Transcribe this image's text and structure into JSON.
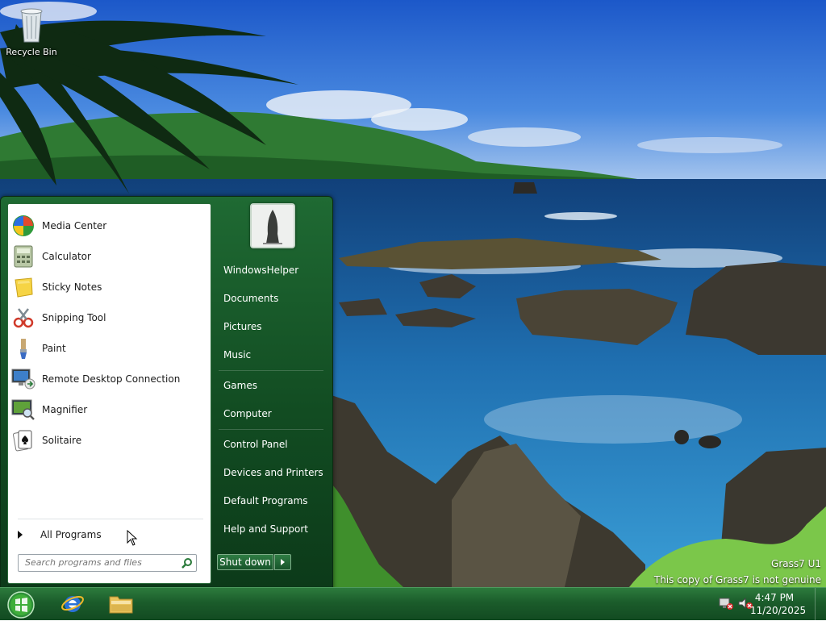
{
  "desktop": {
    "icons": [
      {
        "label": "Recycle Bin",
        "icon": "recycle-bin-icon"
      }
    ],
    "watermark": {
      "line1": "Grass7 U1",
      "line2": "This copy of Grass7 is not genuine"
    }
  },
  "start_menu": {
    "programs": [
      {
        "label": "Media Center",
        "icon": "media-center-icon"
      },
      {
        "label": "Calculator",
        "icon": "calculator-icon"
      },
      {
        "label": "Sticky Notes",
        "icon": "sticky-notes-icon"
      },
      {
        "label": "Snipping Tool",
        "icon": "snipping-tool-icon"
      },
      {
        "label": "Paint",
        "icon": "paint-icon"
      },
      {
        "label": "Remote Desktop Connection",
        "icon": "remote-desktop-icon"
      },
      {
        "label": "Magnifier",
        "icon": "magnifier-icon"
      },
      {
        "label": "Solitaire",
        "icon": "solitaire-icon"
      }
    ],
    "all_programs": "All Programs",
    "search_placeholder": "Search programs and files",
    "right_items": [
      {
        "label": "WindowsHelper"
      },
      {
        "label": "Documents"
      },
      {
        "label": "Pictures"
      },
      {
        "label": "Music"
      },
      {
        "label": "Games"
      },
      {
        "label": "Computer"
      },
      {
        "label": "Control Panel"
      },
      {
        "label": "Devices and Printers"
      },
      {
        "label": "Default Programs"
      },
      {
        "label": "Help and Support"
      }
    ],
    "shutdown_label": "Shut down"
  },
  "taskbar": {
    "pinned": [
      {
        "name": "internet-explorer-icon"
      },
      {
        "name": "file-explorer-icon"
      }
    ],
    "tray": {
      "time": "4:47 PM",
      "date": "11/20/2025"
    }
  },
  "colors": {
    "accent": "#1b5c2b",
    "start_orb": "#3fae3a"
  }
}
